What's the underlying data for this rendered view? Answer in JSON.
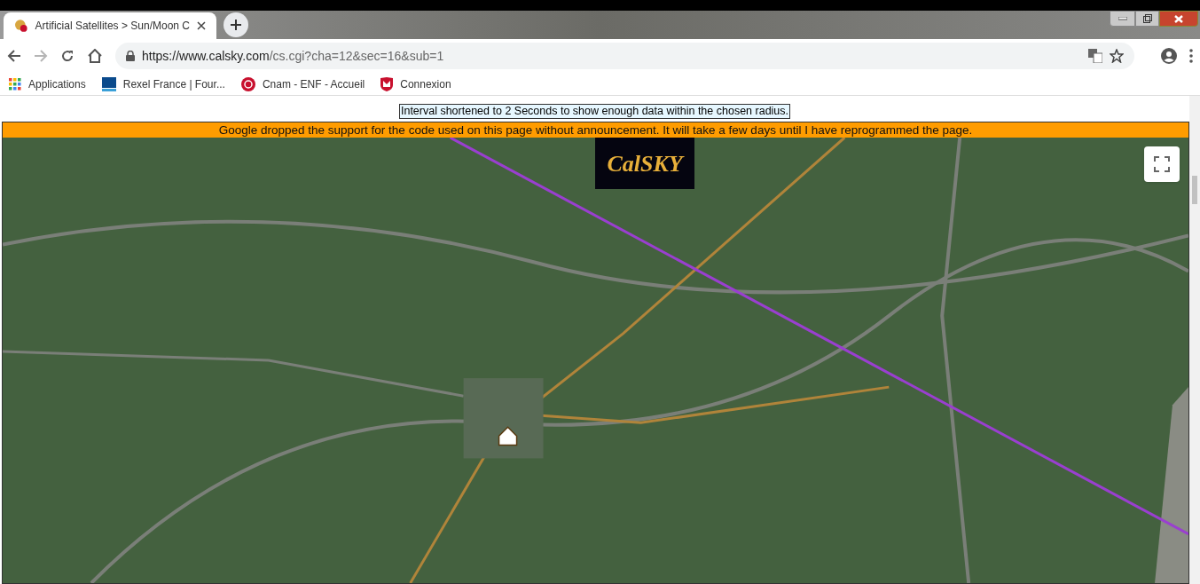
{
  "tab": {
    "title": "Artificial Satellites > Sun/Moon C",
    "selected": true
  },
  "address_bar": {
    "url_host": "https://www.calsky.com",
    "url_path": "/cs.cgi?cha=12&sec=16&sub=1"
  },
  "bookmarks": [
    {
      "label": "Applications",
      "kind": "apps"
    },
    {
      "label": "Rexel France | Four...",
      "kind": "rexel"
    },
    {
      "label": "Cnam - ENF - Accueil",
      "kind": "cnam"
    },
    {
      "label": "Connexion",
      "kind": "shield"
    }
  ],
  "notice": "Interval shortened to 2 Seconds to show enough data within the chosen radius.",
  "warning": "Google dropped the support for the code used on this page without announcement. It will take a few days until I have reprogrammed the page.",
  "map": {
    "kind": "picture",
    "logo": "CalSKY"
  }
}
